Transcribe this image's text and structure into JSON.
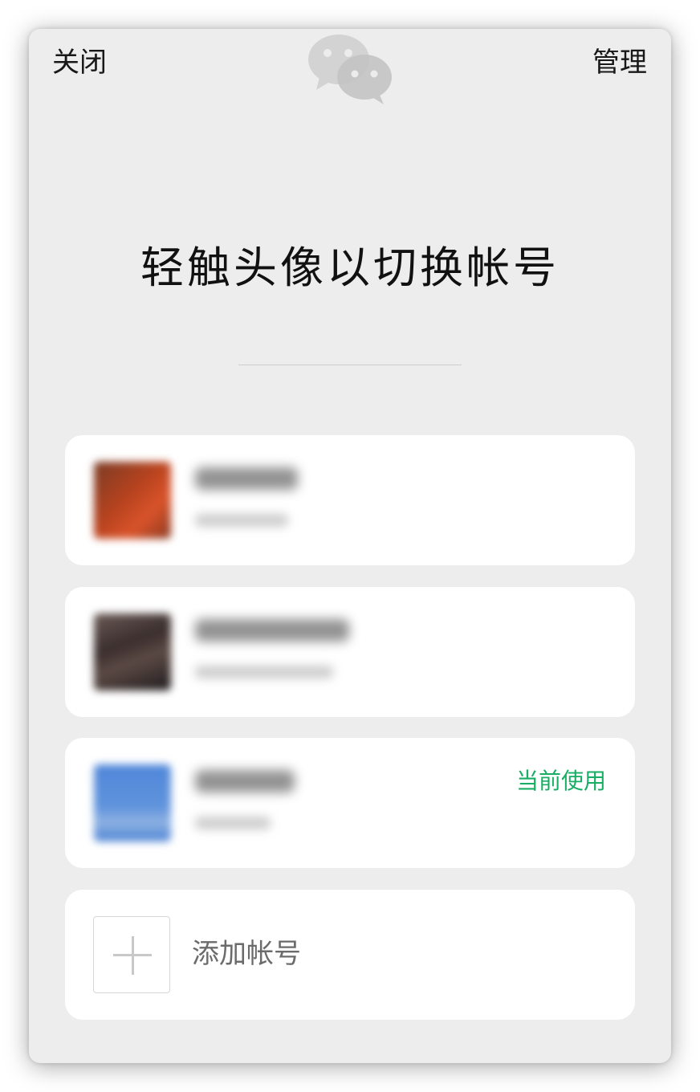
{
  "header": {
    "close_label": "关闭",
    "manage_label": "管理",
    "logo_icon": "wechat-logo-icon"
  },
  "main": {
    "title": "轻触头像以切换帐号"
  },
  "accounts": [
    {
      "avatar_color": "#c9492a",
      "is_current": false
    },
    {
      "avatar_color": "#3a2e2e",
      "is_current": false
    },
    {
      "avatar_color": "#5f93dc",
      "is_current": true,
      "current_label": "当前使用"
    }
  ],
  "add_account": {
    "label": "添加帐号",
    "icon": "plus-icon"
  },
  "colors": {
    "panel_background": "#ededed",
    "card_background": "#ffffff",
    "current_accent": "#1aad64",
    "logo_gray": "#cfcfcf"
  }
}
